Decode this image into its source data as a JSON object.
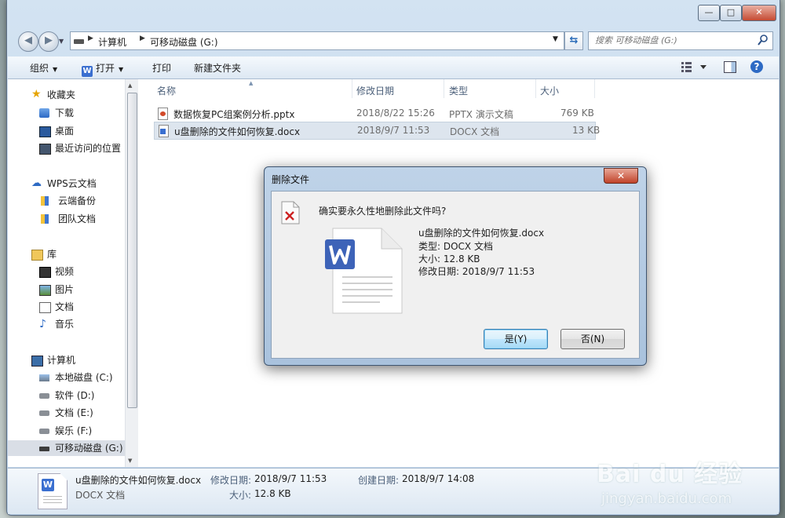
{
  "window": {
    "min_glyph": "—",
    "max_glyph": "□",
    "close_glyph": "✕"
  },
  "address": {
    "crumbs": [
      "计算机",
      "可移动磁盘 (G:)"
    ]
  },
  "search": {
    "placeholder": "搜索 可移动磁盘 (G:)"
  },
  "toolbar": {
    "organize": "组织",
    "open": "打开",
    "print": "打印",
    "new_folder": "新建文件夹"
  },
  "sidebar": {
    "favorites": "收藏夹",
    "downloads": "下载",
    "desktop": "桌面",
    "recent": "最近访问的位置",
    "wps_cloud": "WPS云文档",
    "cloud_backup": "云端备份",
    "team_docs": "团队文档",
    "libraries": "库",
    "videos": "视频",
    "pictures": "图片",
    "documents": "文档",
    "music": "音乐",
    "computer": "计算机",
    "drive_c": "本地磁盘 (C:)",
    "drive_d": "软件 (D:)",
    "drive_e": "文档 (E:)",
    "drive_f": "娱乐 (F:)",
    "drive_g": "可移动磁盘 (G:)"
  },
  "columns": {
    "name": "名称",
    "modified": "修改日期",
    "type": "类型",
    "size": "大小"
  },
  "files": [
    {
      "name": "数据恢复PC组案例分析.pptx",
      "modified": "2018/8/22 15:26",
      "type": "PPTX 演示文稿",
      "size": "769 KB"
    },
    {
      "name": "u盘删除的文件如何恢复.docx",
      "modified": "2018/9/7 11:53",
      "type": "DOCX 文档",
      "size": "13 KB"
    }
  ],
  "details": {
    "filename": "u盘删除的文件如何恢复.docx",
    "filetype": "DOCX 文档",
    "modified_label": "修改日期:",
    "modified": "2018/9/7 11:53",
    "created_label": "创建日期:",
    "created": "2018/9/7 14:08",
    "size_label": "大小:",
    "size": "12.8 KB"
  },
  "dialog": {
    "title": "删除文件",
    "close_glyph": "✕",
    "question": "确实要永久性地删除此文件吗?",
    "file_name": "u盘删除的文件如何恢复.docx",
    "file_type": "类型: DOCX 文档",
    "file_size": "大小: 12.8 KB",
    "file_modified": "修改日期: 2018/9/7 11:53",
    "yes": "是(Y)",
    "no": "否(N)"
  },
  "watermark": {
    "brand": "Bai du 经验",
    "url": "jingyan.baidu.com"
  },
  "colors": {
    "accent": "#3a6fd0",
    "selection": "#dde5ee",
    "close_red": "#c0432a"
  },
  "icons": [
    "back-icon",
    "forward-icon",
    "refresh-icon",
    "search-icon",
    "help-icon",
    "star-icon",
    "folder-icon",
    "cloud-icon",
    "library-icon",
    "computer-icon",
    "drive-icon",
    "wps-icon",
    "delete-document-icon"
  ]
}
